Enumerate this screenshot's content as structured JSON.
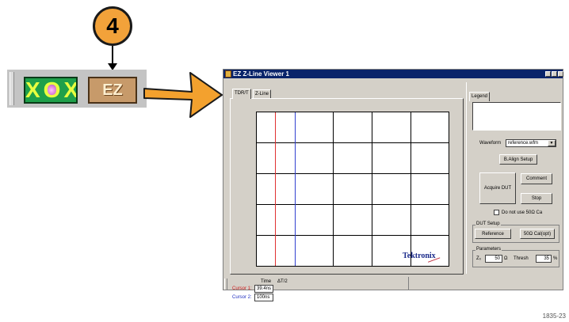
{
  "callout": {
    "number": "4"
  },
  "toolbar": {
    "xox_button": {
      "label": "XOX",
      "icon": "xox-crossing-icon"
    },
    "ez_button": {
      "label": "EZ",
      "icon": "ez-icon"
    }
  },
  "window": {
    "title": "EZ Z-Line Viewer 1",
    "controls": {
      "minimize": "_",
      "maximize": "□",
      "close": "×"
    },
    "tabs": [
      {
        "label": "TDR/T",
        "active": true
      },
      {
        "label": "Z-Line",
        "active": false
      }
    ],
    "plot": {
      "brand": "Tektronix",
      "cursor_colors": {
        "cursor1": "#e03030",
        "cursor2": "#3040d0"
      }
    },
    "legend": {
      "tab_label": "Legend"
    },
    "waveform": {
      "label": "Waveform",
      "value": "reference.wfm"
    },
    "buttons": {
      "b_align_setup": "B.Align Setup",
      "acquire_dut": "Acquire DUT",
      "comment": "Comment",
      "stop": "Stop",
      "reference": "Reference",
      "cal": "50Ω Cal(opt)"
    },
    "no_cal_option": "Do not use 50Ω Ca",
    "dut_setup": {
      "title": "DUT Setup"
    },
    "parameters": {
      "title": "Parameters",
      "z0_label": "Z₀",
      "z0_value": "50",
      "z0_unit": "Ω",
      "threshold_label": "Thresh",
      "threshold_value": "35",
      "threshold_unit": "%"
    },
    "status": {
      "time_label": "Time",
      "delta_label": "ΔT/2",
      "cursor1_label": "Cursor 1:",
      "cursor1_value": "39.4ns",
      "cursor2_label": "Cursor 2:",
      "cursor2_value": "100ns"
    }
  },
  "figure_number": "1835-23"
}
